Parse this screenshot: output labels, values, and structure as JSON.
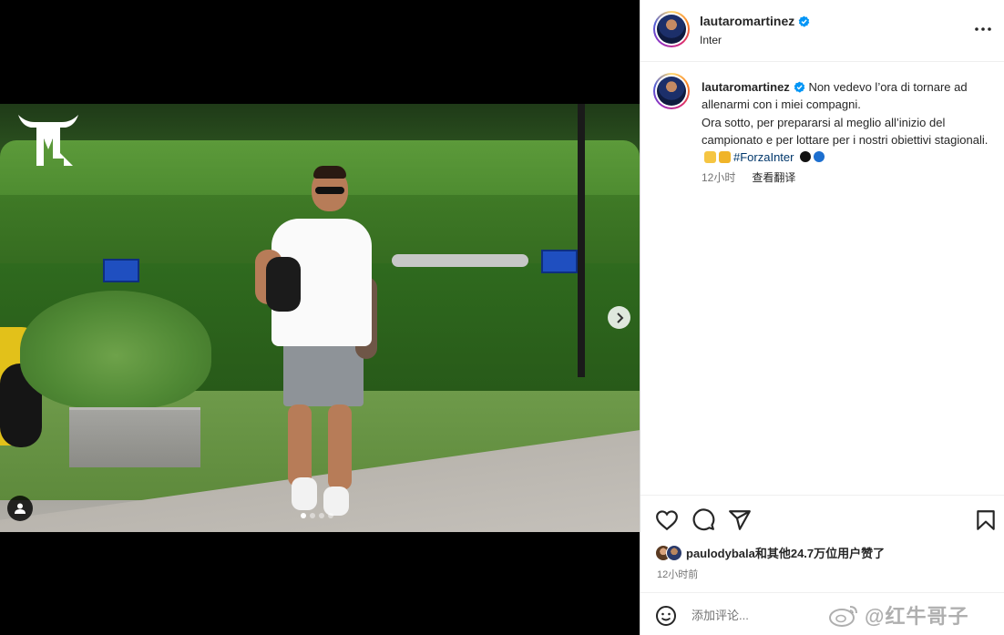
{
  "post": {
    "author": "lautaromartinez",
    "location": "Inter",
    "caption_line1": "Non vedevo l’ora di tornare ad allenarmi con i miei compagni.",
    "caption_line2": "Ora sotto, per prepararsi al meglio all’inizio del campionato e per lottare per i nostri obiettivi stagionali.",
    "hashtag": "#ForzaInter",
    "caption_time": "12小时",
    "translate_label": "查看翻译",
    "likes_text": "paulodybala和其他24.7万位用户赞了",
    "post_time": "12小时前",
    "comment_placeholder": "添加评论...",
    "watermark": "@红牛哥子",
    "carousel": {
      "count": 4,
      "active": 0
    }
  },
  "icons": [
    "verified-icon",
    "more-icon",
    "heart-icon",
    "comment-icon",
    "share-icon",
    "bookmark-icon",
    "emoji-icon",
    "next-icon",
    "user-tag-icon",
    "weibo-icon"
  ],
  "colors": {
    "verified": "#0095f6",
    "hashtag": "#00376b",
    "meta": "#737373",
    "border": "#dbdbdb",
    "emoji_black": "#111111",
    "emoji_blue": "#1d6fcf"
  }
}
